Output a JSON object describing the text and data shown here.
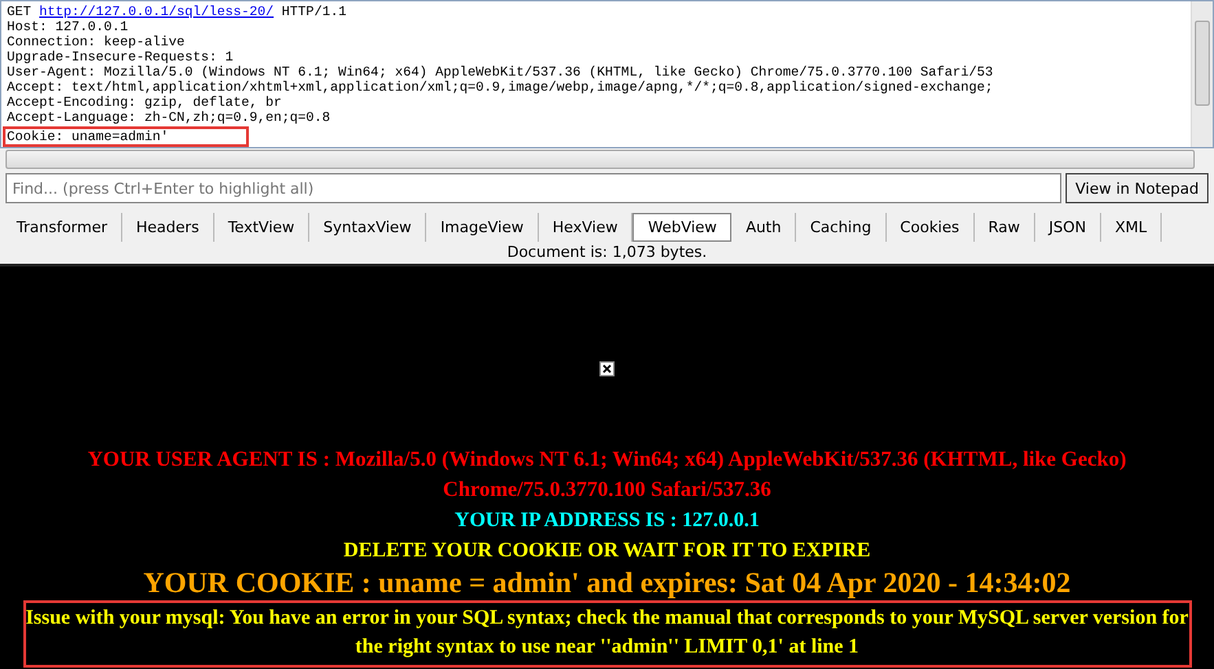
{
  "request": {
    "method": "GET",
    "url": "http://127.0.0.1/sql/less-20/",
    "version": "HTTP/1.1",
    "headers": [
      {
        "text": "Host: 127.0.0.1",
        "highlighted": false
      },
      {
        "text": "Connection: keep-alive",
        "highlighted": false
      },
      {
        "text": "Upgrade-Insecure-Requests: 1",
        "highlighted": false
      },
      {
        "text": "User-Agent: Mozilla/5.0 (Windows NT 6.1; Win64; x64) AppleWebKit/537.36 (KHTML, like Gecko) Chrome/75.0.3770.100 Safari/53",
        "highlighted": false
      },
      {
        "text": "Accept: text/html,application/xhtml+xml,application/xml;q=0.9,image/webp,image/apng,*/*;q=0.8,application/signed-exchange;",
        "highlighted": false
      },
      {
        "text": "Accept-Encoding: gzip, deflate, br",
        "highlighted": false
      },
      {
        "text": "Accept-Language: zh-CN,zh;q=0.9,en;q=0.8",
        "highlighted": false
      },
      {
        "text": "Cookie: uname=admin'",
        "highlighted": true
      }
    ]
  },
  "find": {
    "placeholder": "Find... (press Ctrl+Enter to highlight all)",
    "button": "View in Notepad"
  },
  "tabs": [
    {
      "label": "Transformer",
      "selected": false
    },
    {
      "label": "Headers",
      "selected": false
    },
    {
      "label": "TextView",
      "selected": false
    },
    {
      "label": "SyntaxView",
      "selected": false
    },
    {
      "label": "ImageView",
      "selected": false
    },
    {
      "label": "HexView",
      "selected": false
    },
    {
      "label": "WebView",
      "selected": true
    },
    {
      "label": "Auth",
      "selected": false
    },
    {
      "label": "Caching",
      "selected": false
    },
    {
      "label": "Cookies",
      "selected": false
    },
    {
      "label": "Raw",
      "selected": false
    },
    {
      "label": "JSON",
      "selected": false
    },
    {
      "label": "XML",
      "selected": false
    }
  ],
  "document_info": "Document is: 1,073 bytes.",
  "web_page": {
    "lines": [
      {
        "kind": "user_agent",
        "text": "YOUR USER AGENT IS : Mozilla/5.0 (Windows NT 6.1; Win64; x64) AppleWebKit/537.36 (KHTML, like Gecko) Chrome/75.0.3770.100 Safari/537.36"
      },
      {
        "kind": "ip",
        "text": "YOUR IP ADDRESS IS : 127.0.0.1"
      },
      {
        "kind": "notice",
        "text": "DELETE YOUR COOKIE OR WAIT FOR IT TO EXPIRE"
      },
      {
        "kind": "cookie",
        "text": "YOUR COOKIE : uname = admin' and expires: Sat 04 Apr 2020 - 14:34:02"
      },
      {
        "kind": "error",
        "text": "Issue with your mysql: You have an error in your SQL syntax; check the manual that corresponds to your MySQL server version for the right syntax to use near ''admin'' LIMIT 0,1' at line 1"
      }
    ]
  }
}
